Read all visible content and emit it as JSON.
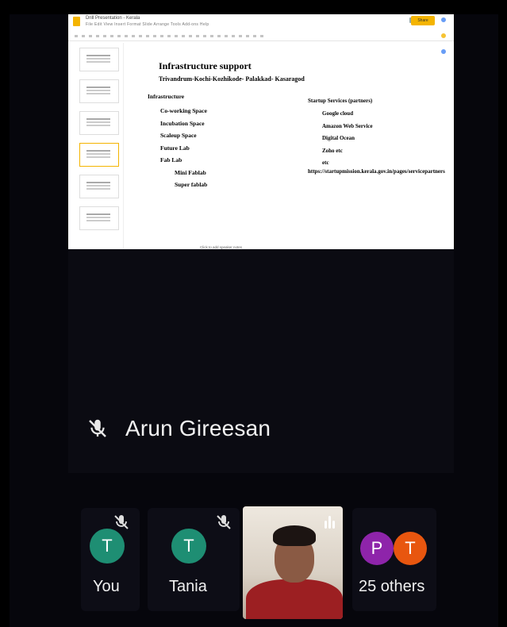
{
  "presentation": {
    "doc_name": "Drill Presentation - Kerala",
    "slide": {
      "title": "Infrastructure support",
      "subtitle": "Trivandrum-Kochi-Kozhikode- Palakkad- Kasaragod",
      "infra_heading": "Infrastructure",
      "infra_items": [
        "Co-working Space",
        "Incubation Space",
        "Scaleup Space",
        "Future Lab",
        "Fab Lab"
      ],
      "fab_lab_items": [
        "Mini Fablab",
        "Super fablab"
      ],
      "partners_heading": "Startup Services (partners)",
      "partners": [
        "Google cloud",
        "Amazon Web Service",
        "Digital Ocean",
        "Zoho etc",
        "etc"
      ],
      "url": "https://startupmission.kerala.gov.in/pages/servicepartners"
    },
    "speaker_notes": "Click to add speaker notes"
  },
  "presenter": {
    "name": "Arun Gireesan"
  },
  "participants": [
    {
      "label": "You",
      "initial": "T",
      "avatar_color": "#1e8e73"
    },
    {
      "label": "Tania",
      "initial": "T",
      "avatar_color": "#1e8e73"
    },
    {
      "label": "25 others",
      "initials": [
        "P",
        "T"
      ],
      "avatar_colors": [
        "#8e24aa",
        "#e8560f"
      ]
    }
  ],
  "colors": {
    "accent": "#f4b400",
    "background": "#06060c"
  }
}
